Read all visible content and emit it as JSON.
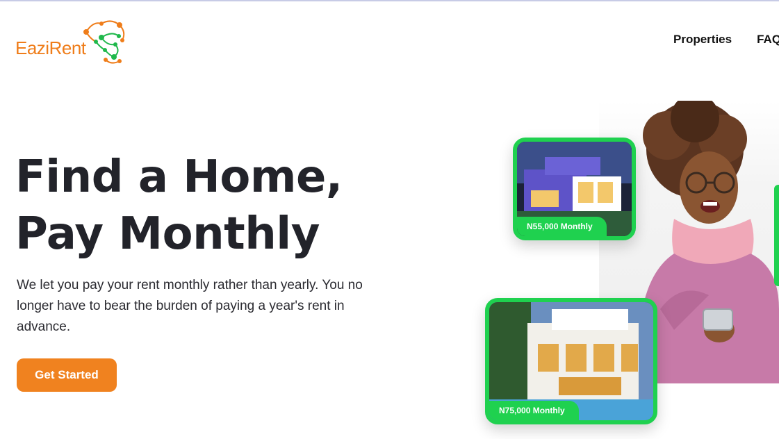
{
  "brand": {
    "name": "EaziRent"
  },
  "nav": {
    "items": [
      "Properties",
      "FAQs"
    ]
  },
  "hero": {
    "title_line1": "Find a Home,",
    "title_line2": "Pay Monthly",
    "description": "We let you pay your rent monthly rather than yearly. You no longer have to bear the burden of paying a year's rent in advance.",
    "cta_label": "Get Started"
  },
  "listings": [
    {
      "price": "N55,000 Monthly"
    },
    {
      "price": "N75,000 Monthly"
    }
  ],
  "colors": {
    "brand_orange": "#f0821f",
    "accent_green": "#1fd14f",
    "text_dark": "#22232a"
  }
}
